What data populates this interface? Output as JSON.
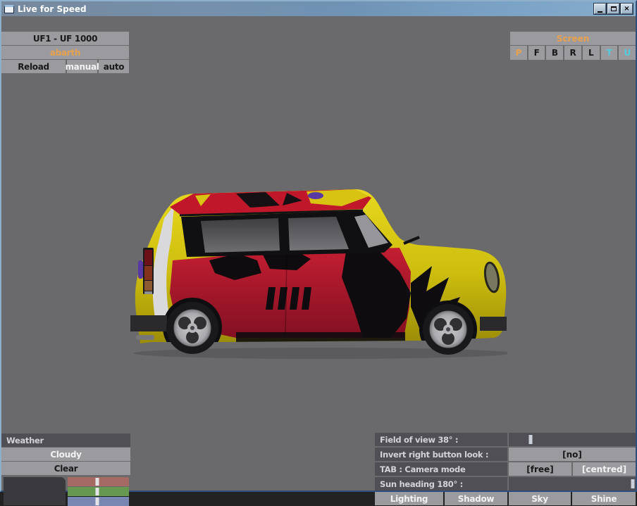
{
  "window": {
    "title": "Live for Speed",
    "controls": {
      "minimize": "minimize",
      "maximize": "maximize",
      "close": "×"
    }
  },
  "vehicle_panel": {
    "model": "UF1 - UF 1000",
    "skin": "abarth",
    "reload": "Reload",
    "manual": "manual",
    "auto": "auto"
  },
  "screen_panel": {
    "title": "Screen",
    "buttons": [
      {
        "label": "P",
        "color": "#e8a14e"
      },
      {
        "label": "F",
        "color": "#19191b"
      },
      {
        "label": "B",
        "color": "#19191b"
      },
      {
        "label": "R",
        "color": "#19191b"
      },
      {
        "label": "L",
        "color": "#19191b"
      },
      {
        "label": "T",
        "color": "#52ccdc"
      },
      {
        "label": "U",
        "color": "#52ccdc"
      }
    ]
  },
  "weather_panel": {
    "title": "Weather",
    "option_selected": "Cloudy",
    "option_other": "Clear",
    "rgb_sliders": [
      {
        "name": "red",
        "color": "#a66a64",
        "value": 0.48
      },
      {
        "name": "green",
        "color": "#67984f",
        "value": 0.48
      },
      {
        "name": "blue",
        "color": "#7787b2",
        "value": 0.48
      }
    ]
  },
  "view_panel": {
    "fov_label": "Field of view 38° :",
    "fov_value": 0.17,
    "invert_label": "Invert right button look :",
    "invert_value": "[no]",
    "tab_label": "TAB : Camera mode",
    "tab_free": "[free]",
    "tab_centred": "[centred]",
    "sun_label": "Sun heading 180° :",
    "sun_value": 0.975,
    "buttons": {
      "lighting": "Lighting",
      "shadow": "Shadow",
      "sky": "Sky",
      "shine": "Shine"
    }
  },
  "colors": {
    "viewport_bg": "#6a696c",
    "button_gray": "#9b9a9e",
    "panel_dark": "#514f56",
    "accent_orange": "#e8a14e",
    "accent_cyan": "#52ccdc",
    "car_yellow": "#d6c50f",
    "car_red": "#bb1a2e",
    "car_black": "#0e0e10",
    "car_window_gray": "#5c5c60",
    "car_purple": "#5838a2"
  }
}
